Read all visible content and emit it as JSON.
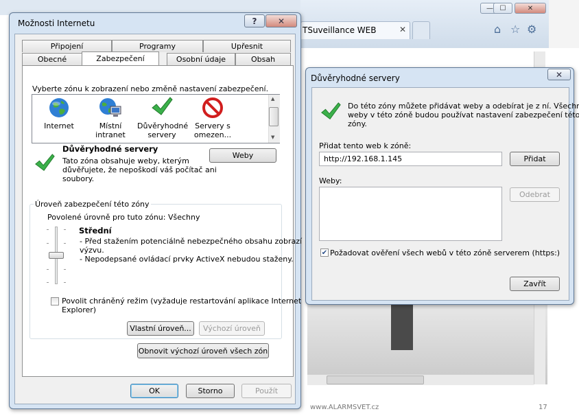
{
  "background": {
    "tab_label": "TSuveillance WEB",
    "tab_close": "✕",
    "footer_url": "www.ALARMSVET.cz",
    "footer_page": "17",
    "window_controls": {
      "minimize": "—",
      "maximize": "☐",
      "close": "✕"
    },
    "toolbar_icons": [
      "home-icon",
      "star-icon",
      "gear-icon"
    ]
  },
  "internet_options": {
    "title": "Možnosti Internetu",
    "help": "?",
    "close": "✕",
    "tabs_row1": [
      "Připojení",
      "Programy",
      "Upřesnit"
    ],
    "tabs_row2": [
      "Obecné",
      "Zabezpečení",
      "Osobní údaje",
      "Obsah"
    ],
    "active_tab": "Zabezpečení",
    "zone_prompt": "Vyberte zónu k zobrazení nebo změně nastavení zabezpečení.",
    "zones": [
      {
        "label1": "Internet",
        "label2": "",
        "icon": "globe-icon"
      },
      {
        "label1": "Místní intranet",
        "label2": "",
        "icon": "intranet-icon"
      },
      {
        "label1": "Důvěryhodné",
        "label2": "servery",
        "icon": "checkmark-icon"
      },
      {
        "label1": "Servery s",
        "label2": "omezen...",
        "icon": "restricted-icon"
      }
    ],
    "selected_zone_title": "Důvěryhodné servery",
    "selected_zone_desc": [
      "Tato zóna obsahuje weby, kterým",
      "důvěřujete, že nepoškodí váš počítač ani",
      "soubory."
    ],
    "sites_button": "Weby",
    "level_group_label": "Úroveň zabezpečení této zóny",
    "allowed_levels": "Povolené úrovně pro tuto zónu: Všechny",
    "level_name": "Střední",
    "level_desc": [
      "- Před stažením potenciálně nebezpečného obsahu zobrazí",
      "výzvu.",
      "- Nepodepsané ovládací prvky ActiveX nebudou staženy."
    ],
    "protected_mode": [
      "Povolit chráněný režim (vyžaduje restartování aplikace Internet",
      "Explorer)"
    ],
    "protected_mode_checked": false,
    "custom_level": "Vlastní úroveň...",
    "default_level": "Výchozí úroveň",
    "reset_all": "Obnovit výchozí úroveň všech zón",
    "ok": "OK",
    "cancel": "Storno",
    "apply": "Použít"
  },
  "trusted_sites": {
    "title": "Důvěryhodné servery",
    "close": "✕",
    "info": [
      "Do této zóny můžete přidávat weby a odebírat je z ní. Všechny",
      "weby v této zóně budou používat nastavení zabezpečení této",
      "zóny."
    ],
    "add_label": "Přidat tento web k zóně:",
    "add_value": "http://192.168.1.145",
    "add_button": "Přidat",
    "sites_label": "Weby:",
    "sites_list": [],
    "remove_button": "Odebrat",
    "require_https": "Požadovat ověření všech webů v této zóně serverem (https:)",
    "require_https_checked": true,
    "close_button": "Zavřít"
  }
}
